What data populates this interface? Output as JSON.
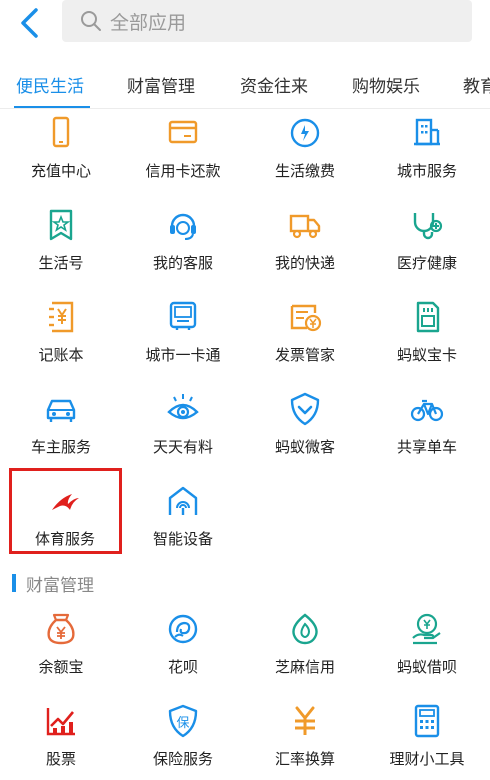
{
  "search": {
    "placeholder": "全部应用"
  },
  "tabs": [
    {
      "label": "便民生活",
      "active": true
    },
    {
      "label": "财富管理",
      "active": false
    },
    {
      "label": "资金往来",
      "active": false
    },
    {
      "label": "购物娱乐",
      "active": false
    },
    {
      "label": "教育",
      "active": false
    }
  ],
  "life_apps": [
    {
      "label": "充值中心",
      "icon": "phone-icon"
    },
    {
      "label": "信用卡还款",
      "icon": "credit-card-icon"
    },
    {
      "label": "生活缴费",
      "icon": "water-drop-icon"
    },
    {
      "label": "城市服务",
      "icon": "building-icon"
    },
    {
      "label": "生活号",
      "icon": "star-badge-icon"
    },
    {
      "label": "我的客服",
      "icon": "headset-icon"
    },
    {
      "label": "我的快递",
      "icon": "truck-icon"
    },
    {
      "label": "医疗健康",
      "icon": "stethoscope-icon"
    },
    {
      "label": "记账本",
      "icon": "yuan-book-icon"
    },
    {
      "label": "城市一卡通",
      "icon": "card-terminal-icon"
    },
    {
      "label": "发票管家",
      "icon": "invoice-icon"
    },
    {
      "label": "蚂蚁宝卡",
      "icon": "sim-card-icon"
    },
    {
      "label": "车主服务",
      "icon": "car-icon"
    },
    {
      "label": "天天有料",
      "icon": "eye-icon"
    },
    {
      "label": "蚂蚁微客",
      "icon": "shield-check-icon"
    },
    {
      "label": "共享单车",
      "icon": "bicycle-icon"
    },
    {
      "label": "体育服务",
      "icon": "swift-bird-icon"
    },
    {
      "label": "智能设备",
      "icon": "smart-home-icon"
    }
  ],
  "wealth_section": {
    "title": "财富管理"
  },
  "wealth_apps": [
    {
      "label": "余额宝",
      "icon": "money-bag-icon"
    },
    {
      "label": "花呗",
      "icon": "flower-icon"
    },
    {
      "label": "芝麻信用",
      "icon": "sesame-icon"
    },
    {
      "label": "蚂蚁借呗",
      "icon": "hand-coin-icon"
    },
    {
      "label": "股票",
      "icon": "stock-chart-icon"
    },
    {
      "label": "保险服务",
      "icon": "insurance-shield-icon"
    },
    {
      "label": "汇率换算",
      "icon": "exchange-icon"
    },
    {
      "label": "理财小工具",
      "icon": "calculator-icon"
    }
  ],
  "colors": {
    "accent": "#1a8fe8",
    "orange": "#f09a2a",
    "teal": "#1aa58f",
    "red": "#e0201d",
    "highlight": "#e0201d"
  }
}
